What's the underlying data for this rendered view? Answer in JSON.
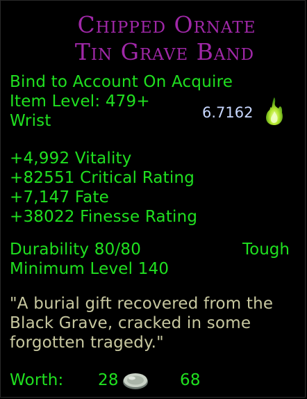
{
  "item": {
    "name_line1": "Chipped Ornate",
    "name_line2": "Tin Grave Band",
    "bind": "Bind to Account On Acquire",
    "item_level": "Item Level: 479+",
    "slot": "Wrist",
    "dps_value": "6.7162",
    "stats": [
      "+4,992 Vitality",
      "+82551 Critical Rating",
      "+7,147 Fate",
      "+38022 Finesse Rating"
    ],
    "durability": "Durability 80/80",
    "durability_type": "Tough",
    "min_level": "Minimum Level 140",
    "flavor": [
      "\"A burial gift recovered from the",
      "Black Grave, cracked in some",
      "forgotten tragedy.\""
    ],
    "worth_label": "Worth:",
    "worth_silver": "28",
    "worth_copper": "68"
  },
  "colors": {
    "title": "#a028a8",
    "text": "#20e020",
    "flavor": "#c8c8a0",
    "dps": "#c8d8ff"
  },
  "icons": {
    "dps": "green-flame-icon",
    "coin": "silver-coin-icon"
  }
}
